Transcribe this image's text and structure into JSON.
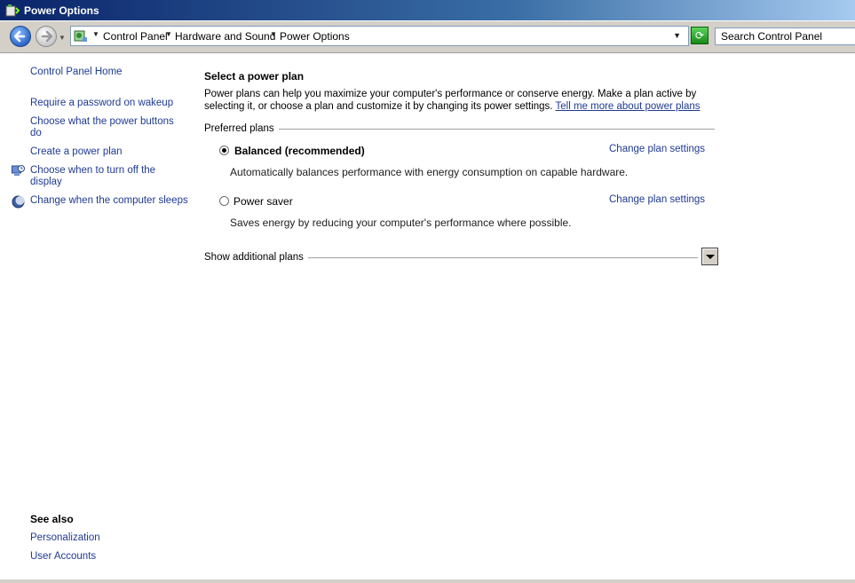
{
  "window": {
    "title": "Power Options"
  },
  "address_bar": {
    "crumbs": [
      "Control Panel",
      "Hardware and Sound",
      "Power Options"
    ]
  },
  "search": {
    "placeholder": "Search Control Panel"
  },
  "left_pane": {
    "home_link": "Control Panel Home",
    "tasks": [
      "Require a password on wakeup",
      "Choose what the power buttons do",
      "Create a power plan",
      "Choose when to turn off the display",
      "Change when the computer sleeps"
    ],
    "see_also_heading": "See also",
    "see_also": [
      "Personalization",
      "User Accounts"
    ]
  },
  "main": {
    "heading": "Select a power plan",
    "intro": "Power plans can help you maximize your computer's performance or conserve energy. Make a plan active by selecting it, or choose a plan and customize it by changing its power settings.",
    "intro_link": "Tell me more about power plans",
    "preferred_label": "Preferred plans",
    "plans": [
      {
        "name": "Balanced (recommended)",
        "selected": true,
        "description": "Automatically balances performance with energy consumption on capable hardware.",
        "change_label": "Change plan settings"
      },
      {
        "name": "Power saver",
        "selected": false,
        "description": "Saves energy by reducing your computer's performance where possible.",
        "change_label": "Change plan settings"
      }
    ],
    "additional_label": "Show additional plans"
  }
}
